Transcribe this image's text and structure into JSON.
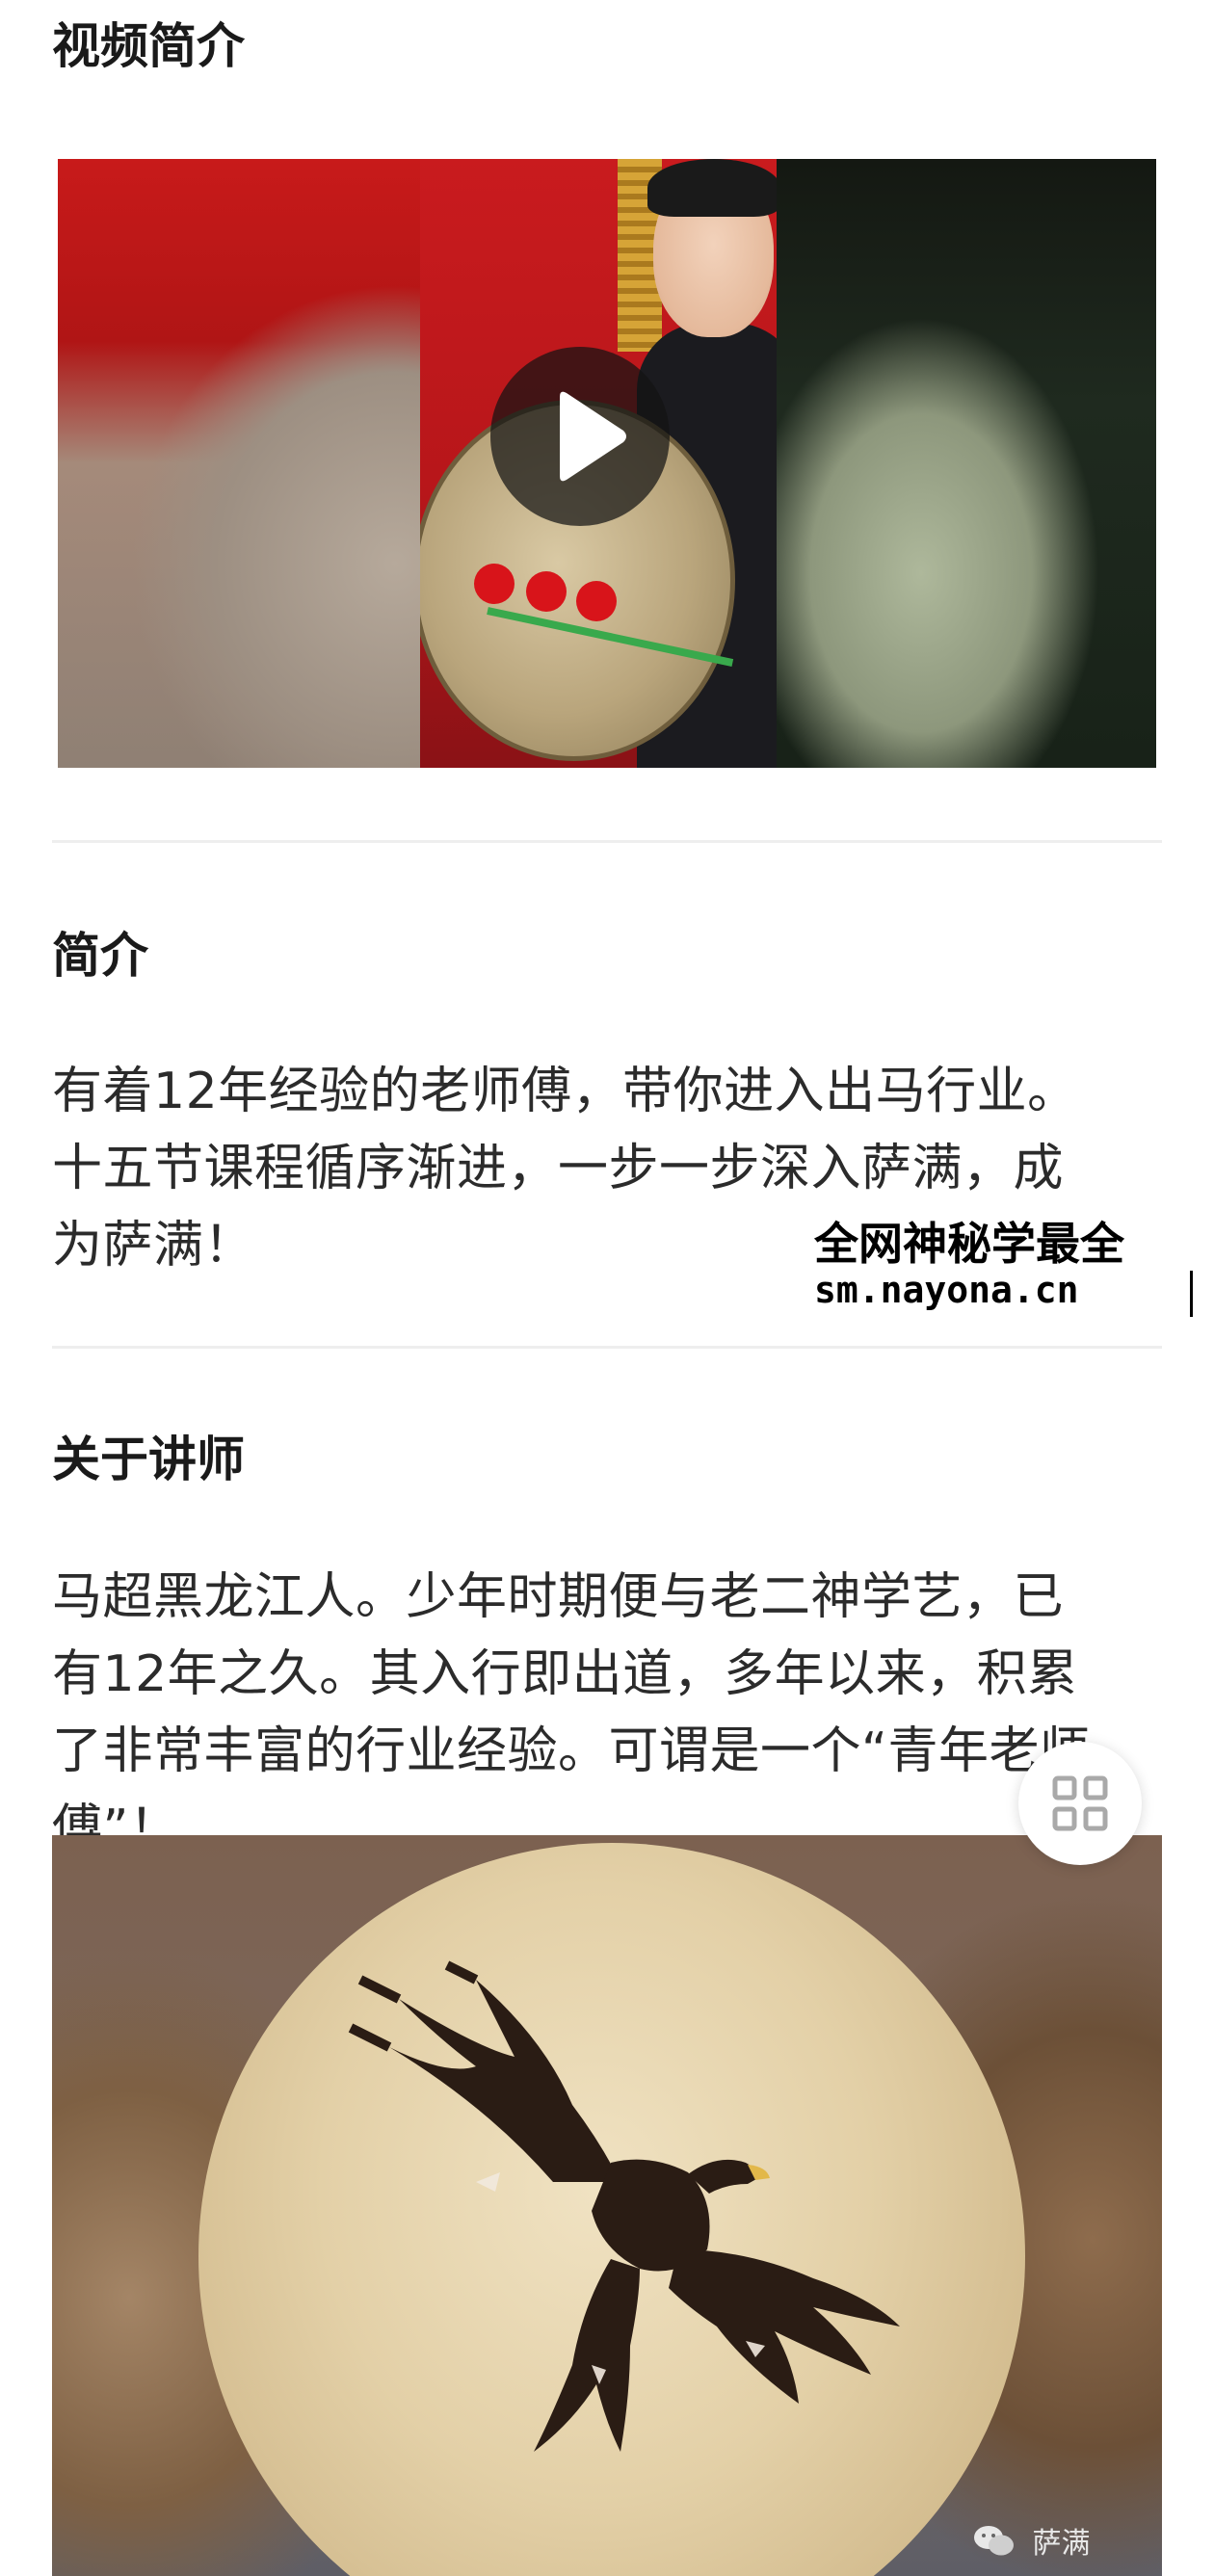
{
  "sections": {
    "video_intro_title": "视频简介",
    "intro_title": "简介",
    "intro_text_lines": [
      "有着12年经验的老师傅，带你进入出马行业。",
      "十五节课程循序渐进，一步一步深入萨满，成",
      "为萨满！"
    ],
    "teacher_title": "关于讲师",
    "teacher_text_lines": [
      "马超黑龙江人。少年时期便与老二神学艺，已",
      "有12年之久。其入行即出道，多年以来，积累",
      "了非常丰富的行业经验。可谓是一个“青年老师",
      "傅”！"
    ]
  },
  "watermark": {
    "line1": "全网神秘学最全",
    "line2": "sm.nayona.cn"
  },
  "image_credit": "萨满",
  "icons": {
    "play": "play-icon",
    "float": "grid-icon",
    "credit": "wechat-icon"
  },
  "colors": {
    "title": "#1a1a1a",
    "text": "#2b2b2b",
    "divider": "#eeeeee",
    "accent_red": "#c91b1e"
  }
}
